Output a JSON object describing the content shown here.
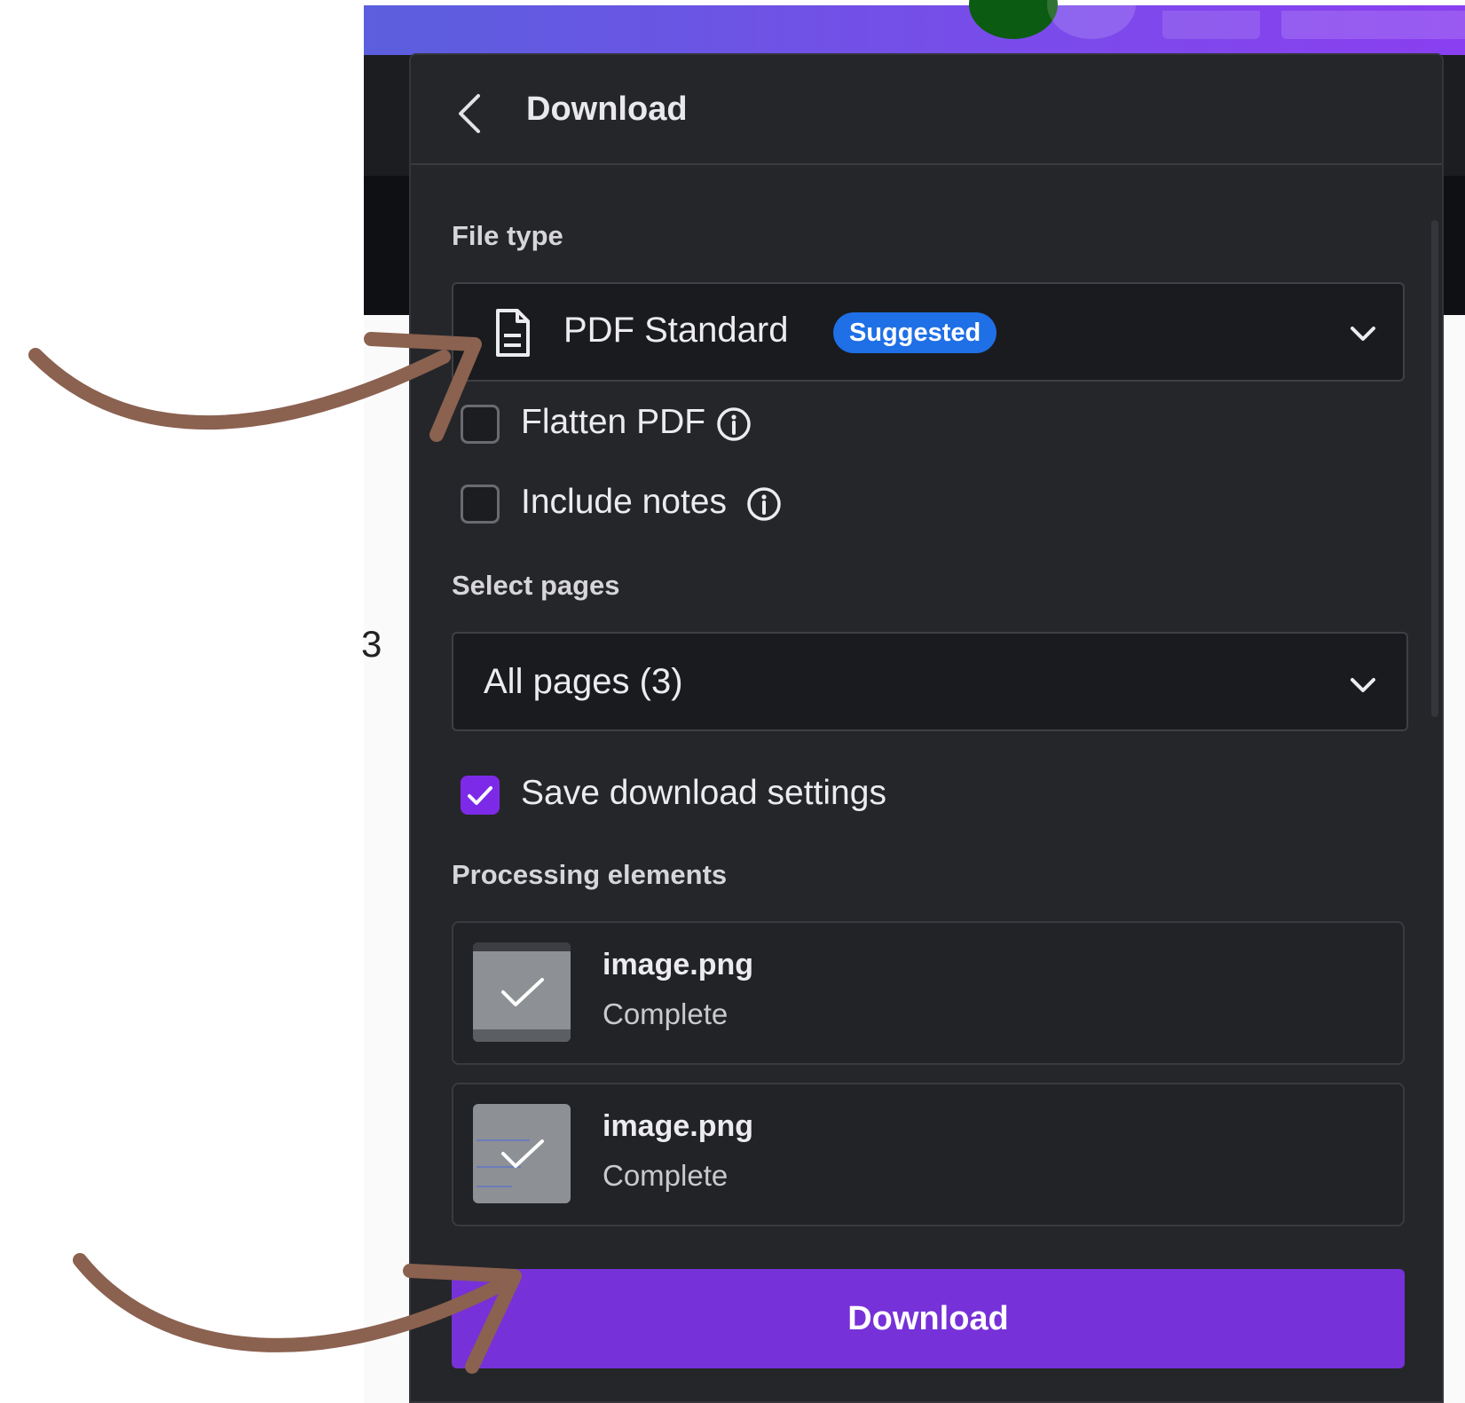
{
  "panel": {
    "title": "Download",
    "file_type": {
      "label": "File type",
      "selected": "PDF Standard",
      "badge": "Suggested"
    },
    "options": {
      "flatten_pdf": {
        "label": "Flatten PDF",
        "checked": false
      },
      "include_notes": {
        "label": "Include notes",
        "checked": false
      }
    },
    "select_pages": {
      "label": "Select pages",
      "selected": "All pages (3)"
    },
    "save_settings": {
      "label": "Save download settings",
      "checked": true
    },
    "processing": {
      "label": "Processing elements",
      "items": [
        {
          "name": "image.png",
          "status": "Complete"
        },
        {
          "name": "image.png",
          "status": "Complete"
        }
      ]
    },
    "download_button": "Download"
  },
  "background": {
    "page_number": "3"
  },
  "colors": {
    "panel_bg": "#252629",
    "accent_purple": "#7731d8",
    "checkbox_purple": "#7d2ae8",
    "badge_blue": "#1f6fe6",
    "arrow_brown": "#8b6150"
  }
}
